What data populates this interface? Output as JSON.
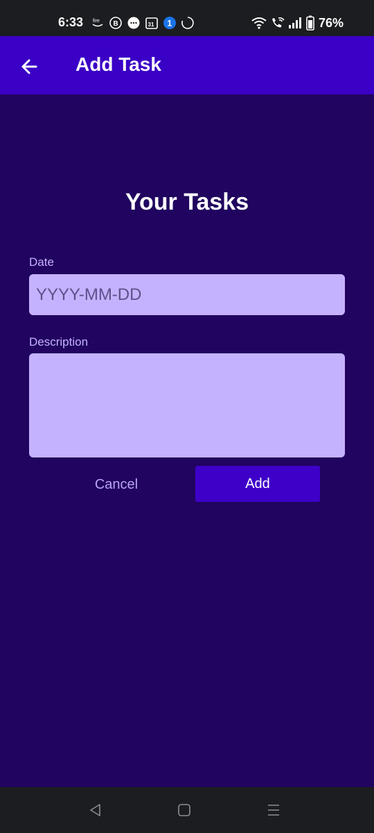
{
  "status_bar": {
    "time": "6:33",
    "left_icons": [
      "firetv-icon",
      "b-circle-icon",
      "chat-bubble-icon",
      "calendar-31-icon",
      "one-badge-icon",
      "loading-ring-icon"
    ],
    "calendar_day": "31",
    "badge_number": "1",
    "right_icons": [
      "wifi-icon",
      "wifi-call-icon",
      "signal-icon",
      "battery-icon"
    ],
    "battery": "76%"
  },
  "app_bar": {
    "title": "Add Task",
    "back_icon": "arrow-left-icon"
  },
  "form": {
    "heading": "Your Tasks",
    "date": {
      "label": "Date",
      "placeholder": "YYYY-MM-DD",
      "value": ""
    },
    "description": {
      "label": "Description",
      "value": ""
    },
    "cancel_label": "Cancel",
    "add_label": "Add"
  },
  "nav_bar": {
    "items": [
      "back-triangle-icon",
      "home-square-icon",
      "recents-menu-icon"
    ]
  },
  "colors": {
    "background": "#20045f",
    "app_bar": "#3b00c6",
    "input_fill": "#c5b2ff",
    "label": "#c6b2ff",
    "add_button": "#3e00c8",
    "system_bars": "#1c1d20"
  }
}
